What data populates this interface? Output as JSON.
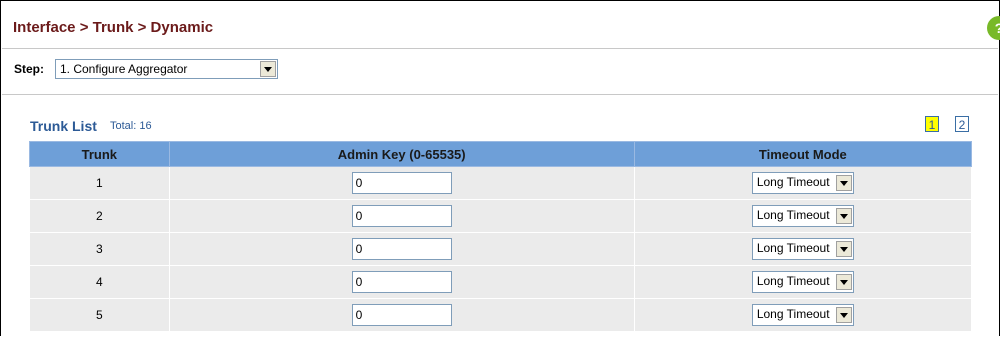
{
  "header": {
    "breadcrumb": "Interface > Trunk > Dynamic",
    "help_icon": "help-icon"
  },
  "step": {
    "label": "Step:",
    "selected": "1. Configure Aggregator"
  },
  "trunk_list": {
    "title": "Trunk List",
    "total": "Total: 16",
    "pages": [
      "1",
      "2"
    ],
    "current_page": "1",
    "columns": [
      "Trunk",
      "Admin Key (0-65535)",
      "Timeout Mode"
    ],
    "rows": [
      {
        "trunk": "1",
        "admin_key": "0",
        "timeout_mode": "Long Timeout"
      },
      {
        "trunk": "2",
        "admin_key": "0",
        "timeout_mode": "Long Timeout"
      },
      {
        "trunk": "3",
        "admin_key": "0",
        "timeout_mode": "Long Timeout"
      },
      {
        "trunk": "4",
        "admin_key": "0",
        "timeout_mode": "Long Timeout"
      },
      {
        "trunk": "5",
        "admin_key": "0",
        "timeout_mode": "Long Timeout"
      }
    ]
  },
  "colors": {
    "title": "#6b1a1a",
    "accent": "#2c5a96",
    "header_bg": "#6e9fd8",
    "row_bg": "#ebebeb",
    "page_active": "#ffff00"
  }
}
